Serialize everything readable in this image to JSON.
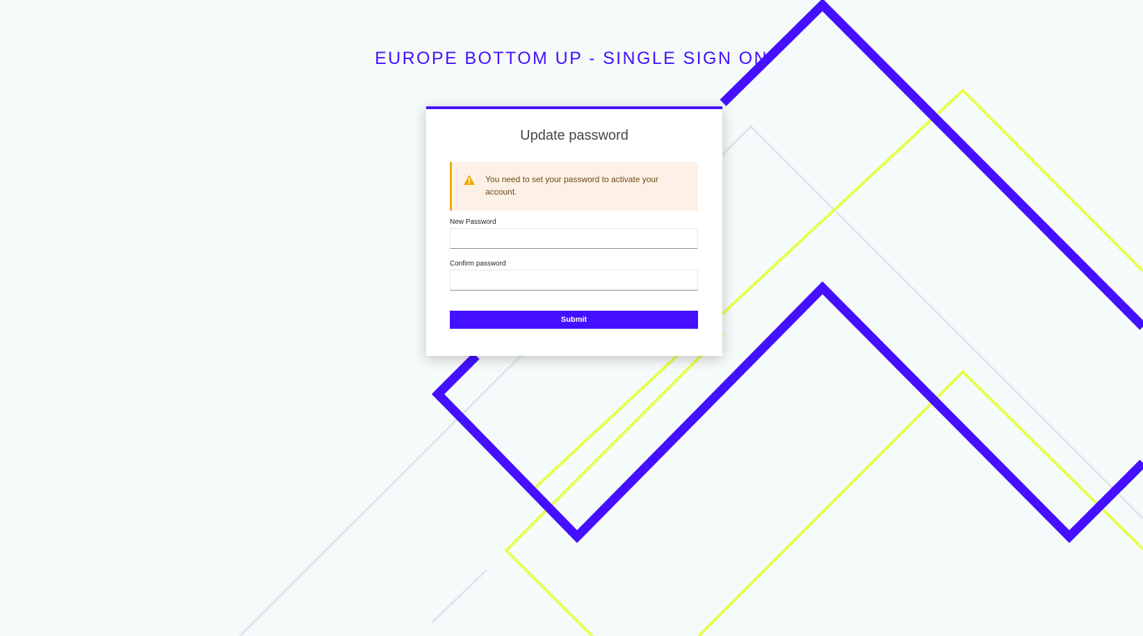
{
  "header": {
    "title": "EUROPE BOTTOM UP - SINGLE SIGN ON"
  },
  "form": {
    "title": "Update password",
    "alert": {
      "icon": "warning-triangle-icon",
      "text": "You need to set your password to activate your account."
    },
    "new_password": {
      "label": "New Password",
      "value": ""
    },
    "confirm_password": {
      "label": "Confirm password",
      "value": ""
    },
    "submit_label": "Submit"
  },
  "colors": {
    "brand": "#4410ff",
    "accent_line": "#e8ff4a",
    "background": "#f5fafa",
    "warning": "#f0ab00",
    "alert_background": "#fdf0e6"
  }
}
